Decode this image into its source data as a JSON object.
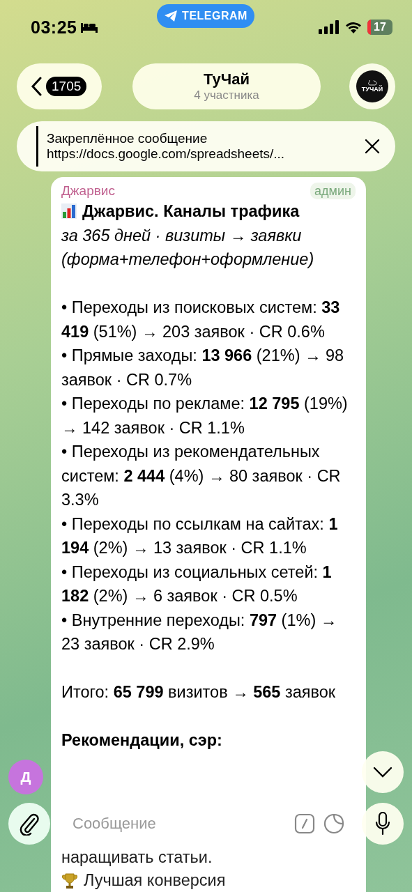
{
  "status_bar": {
    "time": "03:25",
    "app_pill": "TELEGRAM",
    "battery": "17"
  },
  "header": {
    "back_count": "1705",
    "title": "ТуЧай",
    "subtitle": "4 участника",
    "avatar_text": "ТУЧАЙ"
  },
  "pinned": {
    "title": "Закреплённое сообщение",
    "text": "https://docs.google.com/spreadsheets/..."
  },
  "message": {
    "sender": "Джарвис",
    "role": "админ",
    "title": "Джарвис. Каналы трафика",
    "subtitle": "за 365 дней · визиты → заявки (форма+телефон+оформление)",
    "items": [
      "• Переходы из поисковых систем: **33 419** (51%) → 203 заявок · CR 0.6%",
      "• Прямые заходы: **13 966** (21%) → 98 заявок · CR 0.7%",
      "• Переходы по рекламе: **12 795** (19%) → 142 заявок · CR 1.1%",
      "• Переходы из рекомендательных систем: **2 444** (4%) → 80 заявок · CR 3.3%",
      "• Переходы по ссылкам на сайтах: **1 194** (2%) → 13 заявок · CR 1.1%",
      "• Переходы из социальных сетей: **1 182** (2%) → 6 заявок · CR 0.5%",
      "• Внутренние переходы: **797** (1%) → 23 заявок · CR 2.9%"
    ],
    "total": "Итого: **65 799** визитов → **565** заявок",
    "recommendations_title": "Рекомендации, сэр:",
    "recommendation_lines": [
      {
        "kind": "text",
        "text": "наращивать статьи."
      },
      {
        "kind": "trophy",
        "text": "Лучшая конверсия"
      }
    ]
  },
  "sender_avatar": "Д",
  "composer": {
    "placeholder": "Сообщение"
  }
}
